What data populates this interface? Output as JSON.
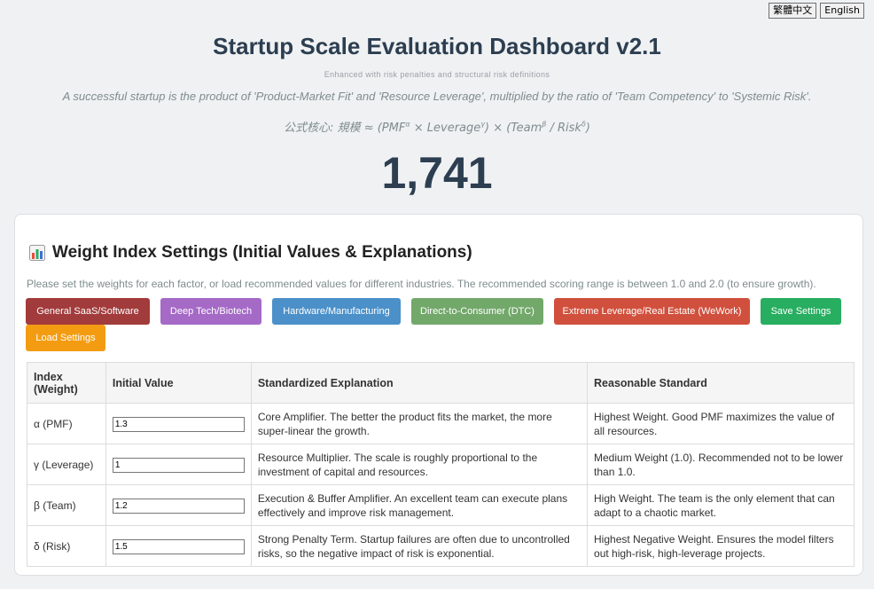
{
  "lang": {
    "zh": "繁體中文",
    "en": "English"
  },
  "header": {
    "title": "Startup Scale Evaluation Dashboard v2.1",
    "subtitle": "Enhanced with risk penalties and structural risk definitions",
    "description": "A successful startup is the product of 'Product-Market Fit' and 'Resource Leverage', multiplied by the ratio of 'Team Competency' to 'Systemic Risk'.",
    "formula_prefix": "公式核心: 規模 ≈ (PMF",
    "formula_a": "α",
    "formula_mid1": " × Leverage",
    "formula_g": "γ",
    "formula_mid2": ") × (Team",
    "formula_b": "β",
    "formula_mid3": " / Risk",
    "formula_d": "δ",
    "formula_end": ")"
  },
  "score": "1,741",
  "panel": {
    "title": "Weight Index Settings (Initial Values & Explanations)",
    "icon": "bar-chart-icon",
    "hint": "Please set the weights for each factor, or load recommended values for different industries. The recommended scoring range is between 1.0 and 2.0 (to ensure growth).",
    "buttons": [
      {
        "label": "General SaaS/Software",
        "color": "#a23b3b"
      },
      {
        "label": "Deep Tech/Biotech",
        "color": "#a569c6"
      },
      {
        "label": "Hardware/Manufacturing",
        "color": "#4b90c9"
      },
      {
        "label": "Direct-to-Consumer (DTC)",
        "color": "#73a86b"
      },
      {
        "label": "Extreme Leverage/Real Estate (WeWork)",
        "color": "#d0503d"
      },
      {
        "label": "Save Settings",
        "color": "#27ae60"
      },
      {
        "label": "Load Settings",
        "color": "#f39c12"
      }
    ],
    "table": {
      "headers": [
        "Index (Weight)",
        "Initial Value",
        "Standardized Explanation",
        "Reasonable Standard"
      ],
      "rows": [
        {
          "index": "α (PMF)",
          "value": "1.3",
          "explanation": "Core Amplifier. The better the product fits the market, the more super-linear the growth.",
          "standard": "Highest Weight. Good PMF maximizes the value of all resources."
        },
        {
          "index": "γ (Leverage)",
          "value": "1",
          "explanation": "Resource Multiplier. The scale is roughly proportional to the investment of capital and resources.",
          "standard": "Medium Weight (1.0). Recommended not to be lower than 1.0."
        },
        {
          "index": "β (Team)",
          "value": "1.2",
          "explanation": "Execution & Buffer Amplifier. An excellent team can execute plans effectively and improve risk management.",
          "standard": "High Weight. The team is the only element that can adapt to a chaotic market."
        },
        {
          "index": "δ (Risk)",
          "value": "1.5",
          "explanation": "Strong Penalty Term. Startup failures are often due to uncontrolled risks, so the negative impact of risk is exponential.",
          "standard": "Highest Negative Weight. Ensures the model filters out high-risk, high-leverage projects."
        }
      ]
    }
  }
}
